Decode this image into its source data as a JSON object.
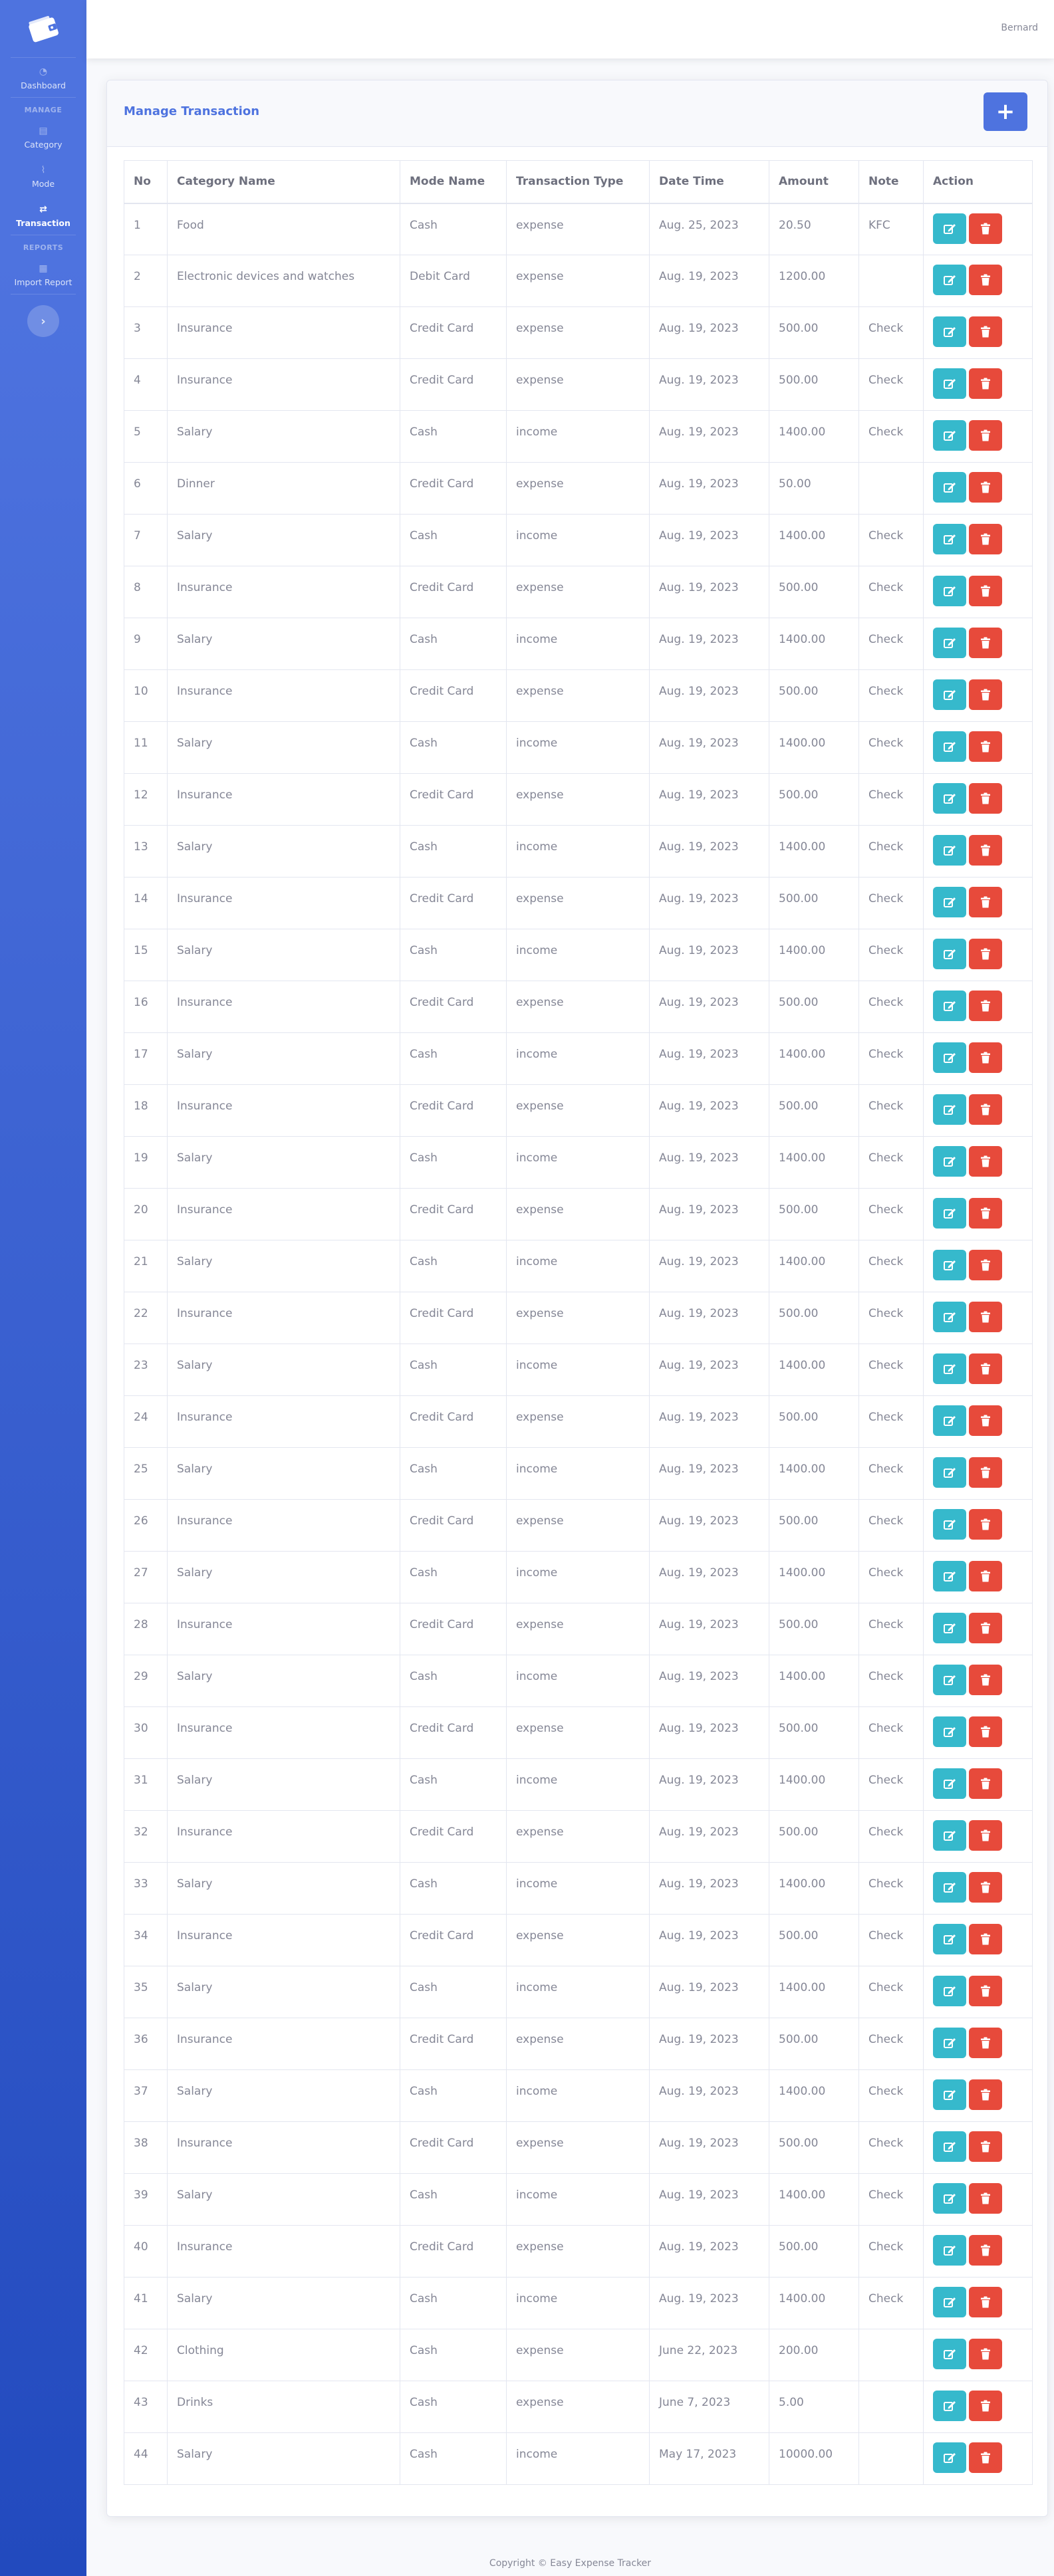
{
  "sidebar": {
    "brand_icon": "wallet-icon",
    "items": [
      {
        "key": "dashboard",
        "label": "Dashboard",
        "icon": "dashboard-icon",
        "active": false
      },
      {
        "key": "category",
        "label": "Category",
        "icon": "box-icon",
        "active": false
      },
      {
        "key": "mode",
        "label": "Mode",
        "icon": "chart-icon",
        "active": false
      },
      {
        "key": "transaction",
        "label": "Transaction",
        "icon": "exchange-icon",
        "active": true
      },
      {
        "key": "import-report",
        "label": "Import Report",
        "icon": "file-icon",
        "active": false
      }
    ],
    "heading_manage": "MANAGE",
    "heading_reports": "REPORTS",
    "toggle_label": "›"
  },
  "topbar": {
    "user_name": "Bernard"
  },
  "card": {
    "title": "Manage Transaction",
    "add_button_label": "+"
  },
  "table": {
    "headers": [
      "No",
      "Category Name",
      "Mode Name",
      "Transaction Type",
      "Date Time",
      "Amount",
      "Note",
      "Action"
    ],
    "rows": [
      [
        "1",
        "Food",
        "Cash",
        "expense",
        "Aug. 25, 2023",
        "20.50",
        "KFC"
      ],
      [
        "2",
        "Electronic devices and watches",
        "Debit Card",
        "expense",
        "Aug. 19, 2023",
        "1200.00",
        ""
      ],
      [
        "3",
        "Insurance",
        "Credit Card",
        "expense",
        "Aug. 19, 2023",
        "500.00",
        "Check"
      ],
      [
        "4",
        "Insurance",
        "Credit Card",
        "expense",
        "Aug. 19, 2023",
        "500.00",
        "Check"
      ],
      [
        "5",
        "Salary",
        "Cash",
        "income",
        "Aug. 19, 2023",
        "1400.00",
        "Check"
      ],
      [
        "6",
        "Dinner",
        "Credit Card",
        "expense",
        "Aug. 19, 2023",
        "50.00",
        ""
      ],
      [
        "7",
        "Salary",
        "Cash",
        "income",
        "Aug. 19, 2023",
        "1400.00",
        "Check"
      ],
      [
        "8",
        "Insurance",
        "Credit Card",
        "expense",
        "Aug. 19, 2023",
        "500.00",
        "Check"
      ],
      [
        "9",
        "Salary",
        "Cash",
        "income",
        "Aug. 19, 2023",
        "1400.00",
        "Check"
      ],
      [
        "10",
        "Insurance",
        "Credit Card",
        "expense",
        "Aug. 19, 2023",
        "500.00",
        "Check"
      ],
      [
        "11",
        "Salary",
        "Cash",
        "income",
        "Aug. 19, 2023",
        "1400.00",
        "Check"
      ],
      [
        "12",
        "Insurance",
        "Credit Card",
        "expense",
        "Aug. 19, 2023",
        "500.00",
        "Check"
      ],
      [
        "13",
        "Salary",
        "Cash",
        "income",
        "Aug. 19, 2023",
        "1400.00",
        "Check"
      ],
      [
        "14",
        "Insurance",
        "Credit Card",
        "expense",
        "Aug. 19, 2023",
        "500.00",
        "Check"
      ],
      [
        "15",
        "Salary",
        "Cash",
        "income",
        "Aug. 19, 2023",
        "1400.00",
        "Check"
      ],
      [
        "16",
        "Insurance",
        "Credit Card",
        "expense",
        "Aug. 19, 2023",
        "500.00",
        "Check"
      ],
      [
        "17",
        "Salary",
        "Cash",
        "income",
        "Aug. 19, 2023",
        "1400.00",
        "Check"
      ],
      [
        "18",
        "Insurance",
        "Credit Card",
        "expense",
        "Aug. 19, 2023",
        "500.00",
        "Check"
      ],
      [
        "19",
        "Salary",
        "Cash",
        "income",
        "Aug. 19, 2023",
        "1400.00",
        "Check"
      ],
      [
        "20",
        "Insurance",
        "Credit Card",
        "expense",
        "Aug. 19, 2023",
        "500.00",
        "Check"
      ],
      [
        "21",
        "Salary",
        "Cash",
        "income",
        "Aug. 19, 2023",
        "1400.00",
        "Check"
      ],
      [
        "22",
        "Insurance",
        "Credit Card",
        "expense",
        "Aug. 19, 2023",
        "500.00",
        "Check"
      ],
      [
        "23",
        "Salary",
        "Cash",
        "income",
        "Aug. 19, 2023",
        "1400.00",
        "Check"
      ],
      [
        "24",
        "Insurance",
        "Credit Card",
        "expense",
        "Aug. 19, 2023",
        "500.00",
        "Check"
      ],
      [
        "25",
        "Salary",
        "Cash",
        "income",
        "Aug. 19, 2023",
        "1400.00",
        "Check"
      ],
      [
        "26",
        "Insurance",
        "Credit Card",
        "expense",
        "Aug. 19, 2023",
        "500.00",
        "Check"
      ],
      [
        "27",
        "Salary",
        "Cash",
        "income",
        "Aug. 19, 2023",
        "1400.00",
        "Check"
      ],
      [
        "28",
        "Insurance",
        "Credit Card",
        "expense",
        "Aug. 19, 2023",
        "500.00",
        "Check"
      ],
      [
        "29",
        "Salary",
        "Cash",
        "income",
        "Aug. 19, 2023",
        "1400.00",
        "Check"
      ],
      [
        "30",
        "Insurance",
        "Credit Card",
        "expense",
        "Aug. 19, 2023",
        "500.00",
        "Check"
      ],
      [
        "31",
        "Salary",
        "Cash",
        "income",
        "Aug. 19, 2023",
        "1400.00",
        "Check"
      ],
      [
        "32",
        "Insurance",
        "Credit Card",
        "expense",
        "Aug. 19, 2023",
        "500.00",
        "Check"
      ],
      [
        "33",
        "Salary",
        "Cash",
        "income",
        "Aug. 19, 2023",
        "1400.00",
        "Check"
      ],
      [
        "34",
        "Insurance",
        "Credit Card",
        "expense",
        "Aug. 19, 2023",
        "500.00",
        "Check"
      ],
      [
        "35",
        "Salary",
        "Cash",
        "income",
        "Aug. 19, 2023",
        "1400.00",
        "Check"
      ],
      [
        "36",
        "Insurance",
        "Credit Card",
        "expense",
        "Aug. 19, 2023",
        "500.00",
        "Check"
      ],
      [
        "37",
        "Salary",
        "Cash",
        "income",
        "Aug. 19, 2023",
        "1400.00",
        "Check"
      ],
      [
        "38",
        "Insurance",
        "Credit Card",
        "expense",
        "Aug. 19, 2023",
        "500.00",
        "Check"
      ],
      [
        "39",
        "Salary",
        "Cash",
        "income",
        "Aug. 19, 2023",
        "1400.00",
        "Check"
      ],
      [
        "40",
        "Insurance",
        "Credit Card",
        "expense",
        "Aug. 19, 2023",
        "500.00",
        "Check"
      ],
      [
        "41",
        "Salary",
        "Cash",
        "income",
        "Aug. 19, 2023",
        "1400.00",
        "Check"
      ],
      [
        "42",
        "Clothing",
        "Cash",
        "expense",
        "June 22, 2023",
        "200.00",
        ""
      ],
      [
        "43",
        "Drinks",
        "Cash",
        "expense",
        "June 7, 2023",
        "5.00",
        ""
      ],
      [
        "44",
        "Salary",
        "Cash",
        "income",
        "May 17, 2023",
        "10000.00",
        ""
      ]
    ],
    "row_actions": {
      "edit_icon": "edit-icon",
      "delete_icon": "trash-icon"
    }
  },
  "footer": {
    "text": "Copyright © Easy Expense Tracker"
  },
  "colors": {
    "primary": "#4e73df",
    "edit": "#36b9cc",
    "delete": "#e74a3b",
    "text": "#858796"
  }
}
